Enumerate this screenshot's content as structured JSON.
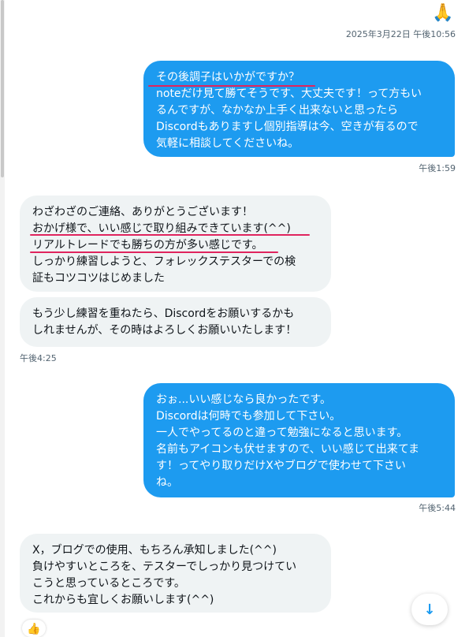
{
  "top_reaction": "🙏",
  "messages": [
    {
      "date_time": "2025年3月22日 午後10:56"
    },
    {
      "lines": [
        "その後調子はいかがですか？",
        "noteだけ見て勝てそうです、大丈夫です！って方もい",
        "るんですが、なかなか上手く出来ないと思ったら",
        "Discordもありますし個別指導は今、空きが有るので",
        "気軽に相談してくださいね。"
      ],
      "time": "午後1:59"
    },
    {
      "lines": [
        "わざわざのご連絡、ありがとうございます！",
        "おかげ様で、いい感じで取り組みできています(^^)",
        "リアルトレードでも勝ちの方が多い感じです。",
        "しっかり練習しようと、フォレックステスターでの検",
        "証もコツコツはじめました"
      ]
    },
    {
      "lines": [
        "もう少し練習を重ねたら、Discordをお願いするかも",
        "しれませんが、その時はよろしくお願いいたします！"
      ],
      "time": "午後4:25"
    },
    {
      "lines": [
        "おぉ...いい感じなら良かったです。",
        "Discordは何時でも参加して下さい。",
        "一人でやってるのと違って勉強になると思います。",
        "名前もアイコンも伏せますので、いい感じて出来てま",
        "す！ってやり取りだけXやブログで使わせて下さい",
        "ね。"
      ],
      "time": "午後5:44"
    },
    {
      "lines": [
        "X，ブログでの使用、もちろん承知しました(^^)",
        "負けやすいところを、テスターでしっかり見つけてい",
        "こうと思っているところです。",
        "これからも宜しくお願いします(^^)"
      ]
    }
  ],
  "bottom_reaction": "👍",
  "scroll_down_icon": "↓",
  "colors": {
    "outgoing_bubble": "#1d9bf0",
    "incoming_bubble": "#eff3f4",
    "highlight_underline": "#e0245e",
    "timestamp_text": "#536471"
  }
}
